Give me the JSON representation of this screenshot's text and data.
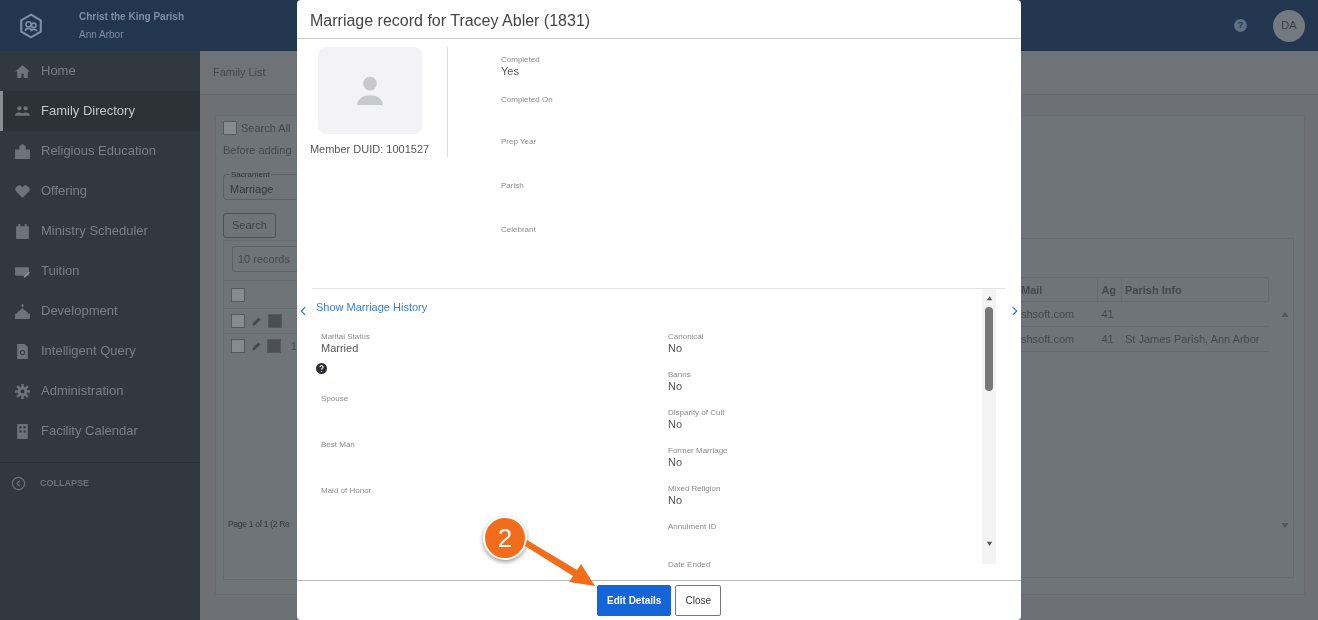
{
  "header": {
    "parish": "Christ the King Parish",
    "city": "Ann Arbor",
    "help": "?",
    "avatar": "DA"
  },
  "sidebar": {
    "items": [
      {
        "label": "Home",
        "selected": false
      },
      {
        "label": "Family Directory",
        "selected": true
      },
      {
        "label": "Religious Education",
        "selected": false
      },
      {
        "label": "Offering",
        "selected": false
      },
      {
        "label": "Ministry Scheduler",
        "selected": false
      },
      {
        "label": "Tuition",
        "selected": false
      },
      {
        "label": "Development",
        "selected": false
      },
      {
        "label": "Intelligent Query",
        "selected": false
      },
      {
        "label": "Administration",
        "selected": false
      },
      {
        "label": "Facility Calendar",
        "selected": false
      }
    ],
    "collapse": "COLLAPSE"
  },
  "background": {
    "tab": "Family List",
    "search_all": {
      "label": "Search All",
      "checked": false
    },
    "note": "Before adding",
    "sacrament": {
      "label": "Sacrament",
      "value": "Marriage"
    },
    "search_button": "Search",
    "page_size": "10 records",
    "all_selected": false,
    "rows": [
      {
        "selected": false,
        "checked": true
      },
      {
        "selected": false,
        "checked": true,
        "cell": "1"
      }
    ],
    "pager": "Page 1 of 1 (2 Re",
    "columns": [
      "Mail",
      "Ag",
      "Parish Info"
    ],
    "right_rows": [
      {
        "cells": [
          "shsoft.com",
          "41",
          ""
        ]
      },
      {
        "cells": [
          "shsoft.com",
          "41",
          "St James Parish, Ann Arbor"
        ]
      }
    ]
  },
  "modal": {
    "title": "Marriage record for Tracey Abler (1831)",
    "member_duid": "Member DUID: 1001527",
    "fields": [
      {
        "label": "Completed",
        "value": "Yes"
      },
      {
        "label": "Completed On"
      },
      {
        "label": "Prep Year"
      },
      {
        "label": "Parish"
      },
      {
        "label": "Celebrant"
      }
    ],
    "history_link": "Show Marriage History",
    "left_fields": [
      {
        "label": "Marital Status",
        "value": "Married",
        "help": true
      },
      {
        "label": "Spouse"
      },
      {
        "label": "Best Man"
      },
      {
        "label": "Maid of Honor"
      }
    ],
    "right_fields": [
      {
        "label": "Canonical",
        "value": "No"
      },
      {
        "label": "Banns",
        "value": "No"
      },
      {
        "label": "Disparity of Cult",
        "value": "No"
      },
      {
        "label": "Former Marriage",
        "value": "No"
      },
      {
        "label": "Mixed Religion",
        "value": "No"
      },
      {
        "label": "Annulment ID"
      },
      {
        "label": "Date Ended"
      }
    ],
    "buttons": [
      {
        "label": "Edit Details",
        "kind": "primary"
      },
      {
        "label": "Close",
        "kind": "secondary"
      }
    ]
  },
  "callout": {
    "number": "2"
  }
}
